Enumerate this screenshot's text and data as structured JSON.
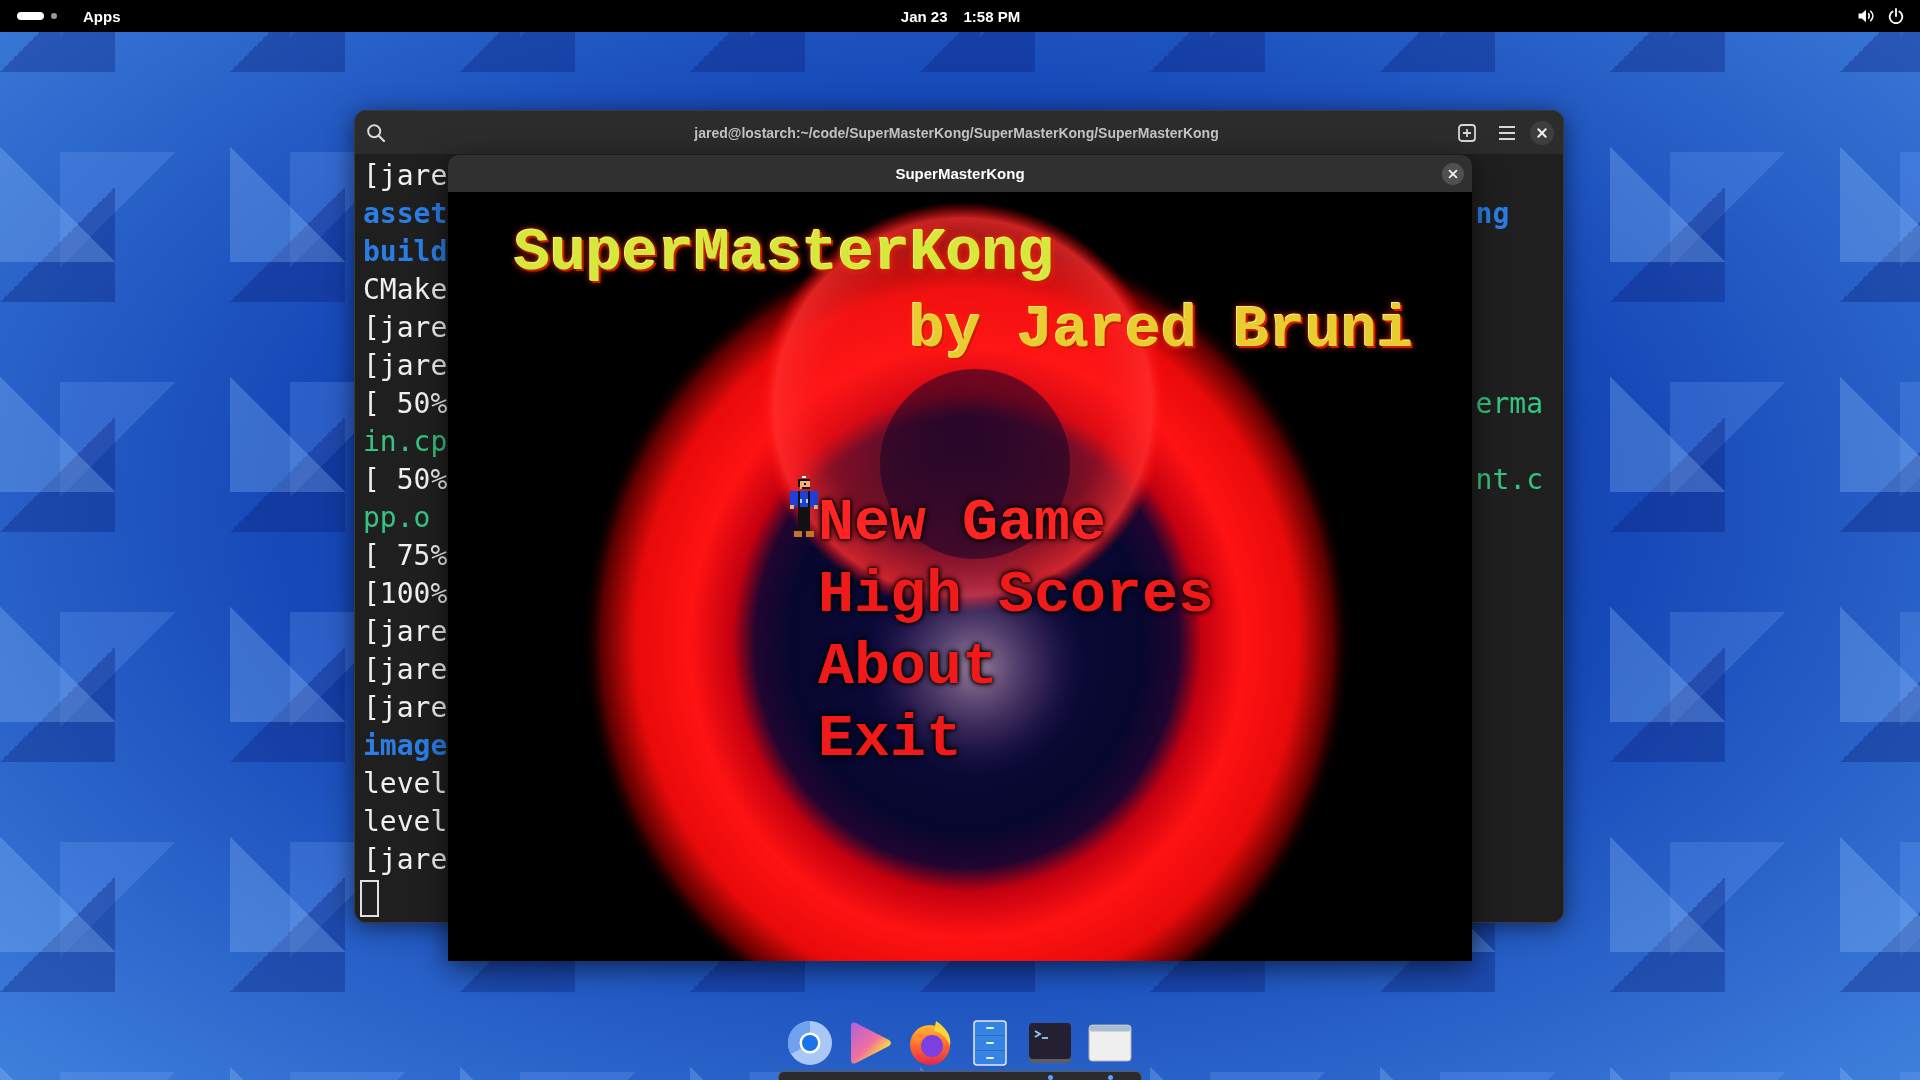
{
  "topbar": {
    "workspaces": [
      {
        "selected": true
      },
      {
        "selected": false
      }
    ],
    "apps": "Apps",
    "clock": {
      "date": "Jan 23",
      "time": "1:58 PM"
    }
  },
  "terminal": {
    "title": "jared@lostarch:~/code/SuperMasterKong/SuperMasterKong/SuperMasterKong",
    "lines": [
      {
        "left": {
          "text": "[jare",
          "kind": "plain"
        }
      },
      {
        "left": {
          "text": "asset",
          "kind": "directory"
        },
        "right": {
          "text": "ng",
          "kind": "directory"
        }
      },
      {
        "left": {
          "text": "build",
          "kind": "directory"
        }
      },
      {
        "left": {
          "text": "CMake",
          "kind": "plain"
        }
      },
      {
        "left": {
          "text": "[jare",
          "kind": "plain"
        }
      },
      {
        "left": {
          "text": "[jare",
          "kind": "plain"
        }
      },
      {
        "left": {
          "text": "[ 50%",
          "kind": "plain"
        },
        "right": {
          "text": "erma",
          "kind": "object"
        }
      },
      {
        "left": {
          "text": "in.cp",
          "kind": "object"
        }
      },
      {
        "left": {
          "text": "[ 50%",
          "kind": "plain"
        },
        "right": {
          "text": "nt.c",
          "kind": "object"
        }
      },
      {
        "left": {
          "text": "pp.o",
          "kind": "object"
        }
      },
      {
        "left": {
          "text": "[ 75%",
          "kind": "plain"
        }
      },
      {
        "left": {
          "text": "[100%",
          "kind": "plain"
        }
      },
      {
        "left": {
          "text": "[jare",
          "kind": "plain"
        }
      },
      {
        "left": {
          "text": "[jare",
          "kind": "plain"
        }
      },
      {
        "left": {
          "text": "[jare",
          "kind": "plain"
        }
      },
      {
        "left": {
          "text": "image",
          "kind": "directory"
        }
      },
      {
        "left": {
          "text": "level",
          "kind": "plain"
        }
      },
      {
        "left": {
          "text": "level",
          "kind": "plain"
        }
      },
      {
        "left": {
          "text": "[jare",
          "kind": "plain"
        }
      }
    ]
  },
  "game": {
    "window_title": "SuperMasterKong",
    "game_title": "SuperMasterKong",
    "byline": "by Jared Bruni",
    "menu": [
      {
        "label": "New Game",
        "selected": true
      },
      {
        "label": "High Scores",
        "selected": false
      },
      {
        "label": "About",
        "selected": false
      },
      {
        "label": "Exit",
        "selected": false
      }
    ]
  },
  "dock": {
    "items": [
      {
        "kind": "circle",
        "running": false
      },
      {
        "kind": "play",
        "running": false
      },
      {
        "kind": "fox",
        "running": false
      },
      {
        "kind": "cabinet",
        "running": false
      },
      {
        "kind": "terminal",
        "running": true
      },
      {
        "kind": "window",
        "running": true
      }
    ]
  }
}
